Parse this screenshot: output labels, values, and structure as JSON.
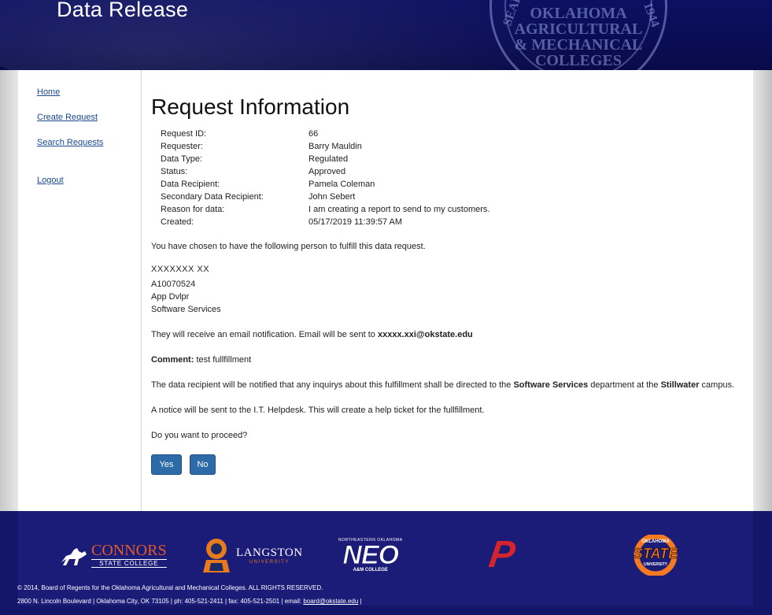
{
  "header": {
    "title": "Data Release",
    "seal_lines": [
      "OKLAHOMA",
      "AGRICULTURAL",
      "& MECHANICAL",
      "COLLEGES"
    ],
    "seal_left": "SEAL",
    "seal_right": "1944"
  },
  "sidebar": {
    "items": [
      {
        "label": "Home"
      },
      {
        "label": "Create Request"
      },
      {
        "label": "Search Requests"
      },
      {
        "label": "Logout"
      }
    ]
  },
  "main": {
    "title": "Request Information",
    "fields": [
      {
        "label": "Request ID:",
        "value": "66"
      },
      {
        "label": "Requester:",
        "value": "Barry Mauldin"
      },
      {
        "label": "Data Type:",
        "value": "Regulated"
      },
      {
        "label": "Status:",
        "value": "Approved"
      },
      {
        "label": "Data Recipient:",
        "value": "Pamela Coleman"
      },
      {
        "label": "Secondary Data Recipient:",
        "value": "John Sebert"
      },
      {
        "label": "Reason for data:",
        "value": "I am creating a report to send to my customers."
      },
      {
        "label": "Created:",
        "value": "05/17/2019 11:39:57 AM"
      }
    ],
    "chosen_text": "You have chosen to have the following person to fulfill this data request.",
    "person": {
      "name": "XXXXXXX XX",
      "id": "A10070524",
      "title": "App Dvlpr",
      "dept": "Software Services"
    },
    "email_text": "They will receive an email notification. Email will be sent to",
    "email": "xxxxx.xxi@okstate.edu",
    "comment_label": "Comment:",
    "comment": "test fullfillment",
    "notify_pre": "The data recipient will be notified that any inquirys about this fulfillment shall be directed to the",
    "notify_dept": "Software Services",
    "notify_mid": "department at the",
    "notify_campus": "Stillwater",
    "notify_post": "campus.",
    "helpdesk_text": "A notice will be sent to the I.T. Helpdesk. This will create a help ticket for the fullfillment.",
    "proceed_text": "Do you want to proceed?",
    "yes_label": "Yes",
    "no_label": "No"
  },
  "footer": {
    "logos": {
      "connors_main": "CONNORS",
      "connors_sub": "STATE COLLEGE",
      "langston_main": "LANGSTON",
      "langston_sub": "UNIVERSITY",
      "neo_main": "NEO",
      "neo_top": "NORTHEASTERN OKLAHOMA",
      "neo_sub": "A&M COLLEGE",
      "panhandle": "P",
      "osu_top": "OKLAHOMA",
      "osu_main": "STATE",
      "osu_sub": "UNIVERSITY"
    },
    "copyright": "© 2014, Board of Regents for the Oklahoma Agricultural and Mechanical Colleges. ALL RIGHTS RESERVED.",
    "address": "2800 N. Lincoln Boulevard | Oklahoma City, OK 73105 | ph: 405-521-2411 | fax: 405-521-2501 | email:",
    "email": "board@okstate.edu",
    "address_end": "|"
  }
}
